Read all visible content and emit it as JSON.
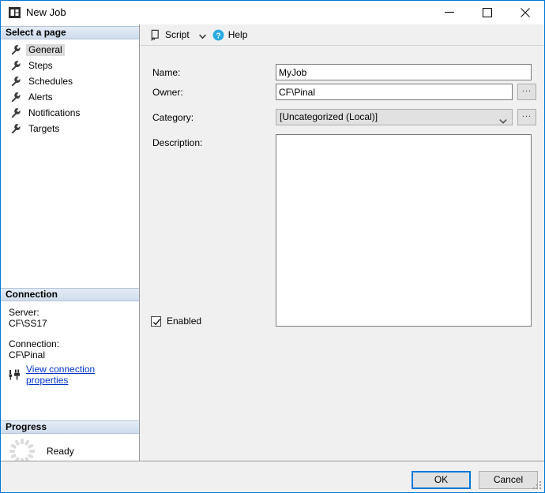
{
  "window": {
    "title": "New Job",
    "icon": "job-window-icon",
    "controls": {
      "minimize": "minimize-icon",
      "maximize": "maximize-icon",
      "close": "close-icon"
    }
  },
  "sidebar": {
    "select_page_header": "Select a page",
    "items": [
      {
        "label": "General",
        "icon": "wrench-icon",
        "selected": true
      },
      {
        "label": "Steps",
        "icon": "wrench-icon",
        "selected": false
      },
      {
        "label": "Schedules",
        "icon": "wrench-icon",
        "selected": false
      },
      {
        "label": "Alerts",
        "icon": "wrench-icon",
        "selected": false
      },
      {
        "label": "Notifications",
        "icon": "wrench-icon",
        "selected": false
      },
      {
        "label": "Targets",
        "icon": "wrench-icon",
        "selected": false
      }
    ],
    "connection": {
      "header": "Connection",
      "server_label": "Server:",
      "server_value": "CF\\SS17",
      "connection_label": "Connection:",
      "connection_value": "CF\\Pinal",
      "link_text": "View connection properties",
      "link_icon": "connection-plug-icon",
      "link_color": "#0033cc"
    },
    "progress": {
      "header": "Progress",
      "status": "Ready",
      "spinner_icon": "progress-spinner-icon"
    }
  },
  "toolbar": {
    "script_label": "Script",
    "script_icon": "script-icon",
    "script_dropdown_icon": "chevron-down-icon",
    "help_label": "Help",
    "help_icon": "help-question-icon"
  },
  "form": {
    "name_label": "Name:",
    "name_value": "MyJob",
    "name_placeholder": "",
    "owner_label": "Owner:",
    "owner_value": "CF\\Pinal",
    "owner_placeholder": "",
    "owner_browse_label": "...",
    "category_label": "Category:",
    "category_value": "[Uncategorized (Local)]",
    "category_options": [
      "[Uncategorized (Local)]"
    ],
    "category_browse_label": "...",
    "description_label": "Description:",
    "description_value": "",
    "description_placeholder": "",
    "enabled_label": "Enabled",
    "enabled_checked": true
  },
  "footer": {
    "ok_label": "OK",
    "cancel_label": "Cancel",
    "resize_grip_icon": "resize-grip-icon"
  },
  "colors": {
    "accent": "#0078d7",
    "dialog_bg": "#f0f0f0",
    "section_header": "#cfdcec",
    "link": "#0033cc",
    "help_blue": "#29abe2"
  }
}
